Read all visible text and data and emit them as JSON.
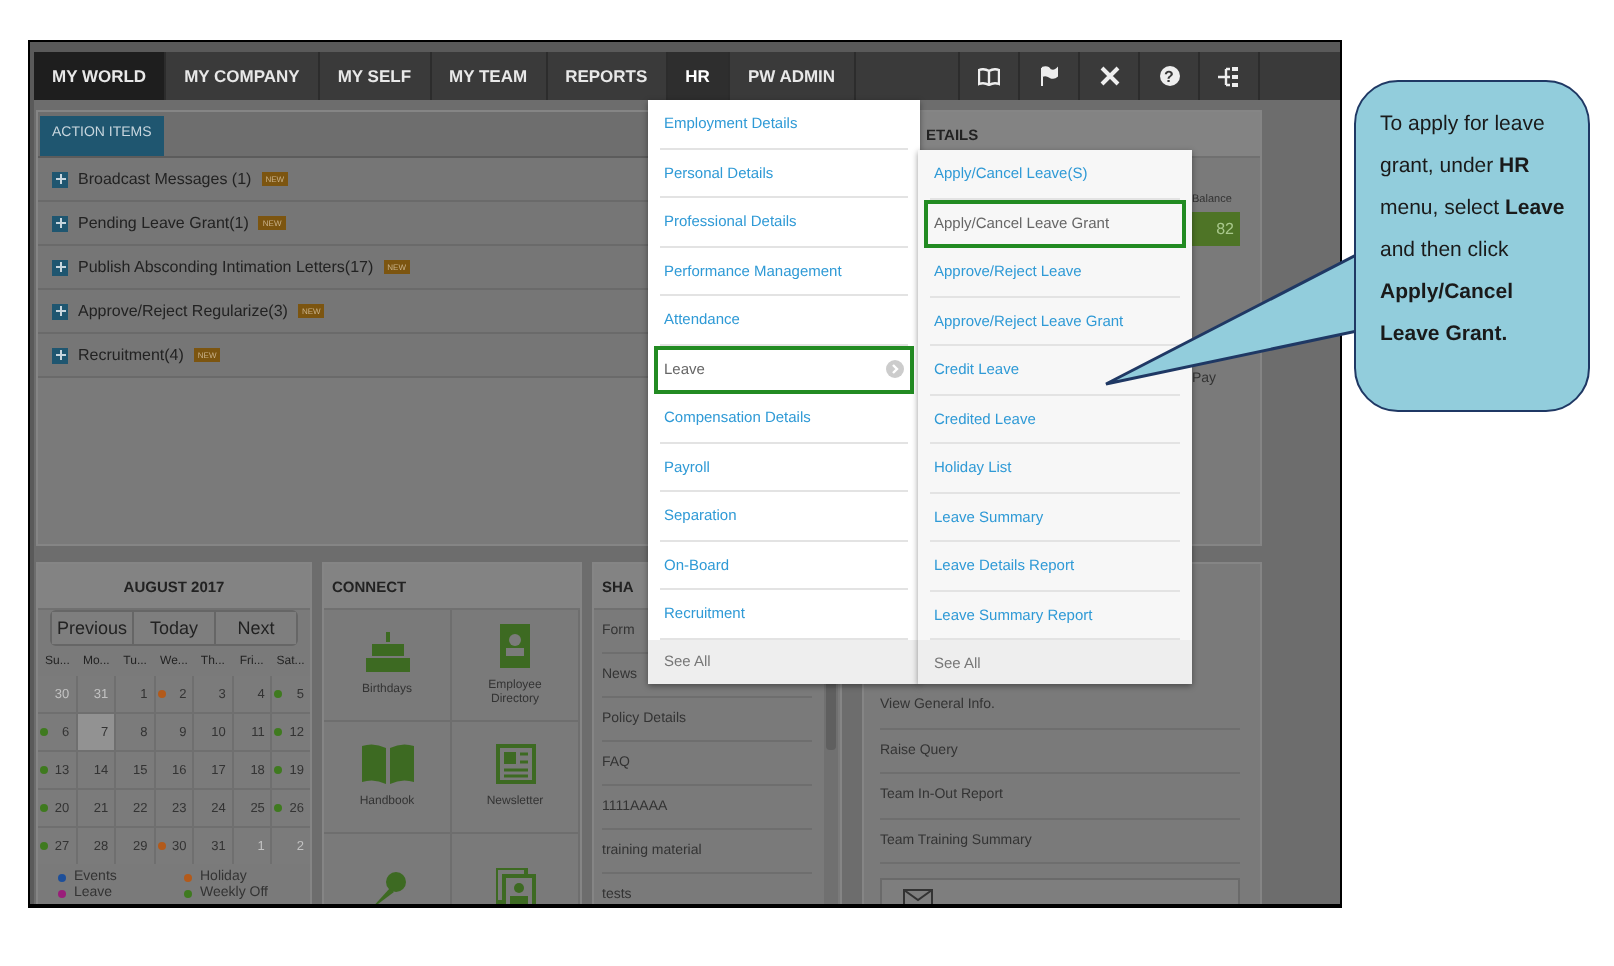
{
  "nav": {
    "tabs": [
      {
        "label": "MY WORLD",
        "selected": true,
        "expanded": false
      },
      {
        "label": "MY COMPANY",
        "selected": false,
        "expanded": false
      },
      {
        "label": "MY SELF",
        "selected": false,
        "expanded": false
      },
      {
        "label": "MY TEAM",
        "selected": false,
        "expanded": false
      },
      {
        "label": "REPORTS",
        "selected": false,
        "expanded": false
      },
      {
        "label": "HR",
        "selected": false,
        "expanded": true
      },
      {
        "label": "PW ADMIN",
        "selected": false,
        "expanded": false
      }
    ],
    "help_glyph": "?"
  },
  "action_items": {
    "tab": "ACTION ITEMS",
    "rows": [
      {
        "label": "Broadcast Messages (1)",
        "badge": "NEW"
      },
      {
        "label": "Pending Leave Grant(1)",
        "badge": "NEW"
      },
      {
        "label": "Publish Absconding Intimation Letters(17)",
        "badge": "NEW"
      },
      {
        "label": "Approve/Reject Regularize(3)",
        "badge": "NEW"
      },
      {
        "label": "Recruitment(4)",
        "badge": "NEW"
      }
    ]
  },
  "details_panel": {
    "title": "ETAILS",
    "balance_label": "Balance",
    "balance_value": "82",
    "pay_label": "Pay"
  },
  "calendar": {
    "title": "AUGUST 2017",
    "buttons": [
      "Previous",
      "Today",
      "Next"
    ],
    "weekdays": [
      "Su...",
      "Mo...",
      "Tu...",
      "We...",
      "Th...",
      "Fri...",
      "Sat..."
    ],
    "weeks": [
      [
        {
          "day": "30",
          "in_month": false,
          "selected": false
        },
        {
          "day": "31",
          "in_month": false,
          "selected": false
        },
        {
          "day": "1",
          "in_month": true,
          "selected": false
        },
        {
          "day": "2",
          "in_month": true,
          "selected": false,
          "color": "#b35a1a"
        },
        {
          "day": "3",
          "in_month": true,
          "selected": false
        },
        {
          "day": "4",
          "in_month": true,
          "selected": false
        },
        {
          "day": "5",
          "in_month": true,
          "selected": false,
          "color": "#3f7a1f"
        }
      ],
      [
        {
          "day": "6",
          "in_month": true,
          "selected": false,
          "color": "#3f7a1f"
        },
        {
          "day": "7",
          "in_month": true,
          "selected": true
        },
        {
          "day": "8",
          "in_month": true,
          "selected": false
        },
        {
          "day": "9",
          "in_month": true,
          "selected": false
        },
        {
          "day": "10",
          "in_month": true,
          "selected": false
        },
        {
          "day": "11",
          "in_month": true,
          "selected": false
        },
        {
          "day": "12",
          "in_month": true,
          "selected": false,
          "color": "#3f7a1f"
        }
      ],
      [
        {
          "day": "13",
          "in_month": true,
          "selected": false,
          "color": "#3f7a1f"
        },
        {
          "day": "14",
          "in_month": true,
          "selected": false
        },
        {
          "day": "15",
          "in_month": true,
          "selected": false
        },
        {
          "day": "16",
          "in_month": true,
          "selected": false
        },
        {
          "day": "17",
          "in_month": true,
          "selected": false
        },
        {
          "day": "18",
          "in_month": true,
          "selected": false
        },
        {
          "day": "19",
          "in_month": true,
          "selected": false,
          "color": "#3f7a1f"
        }
      ],
      [
        {
          "day": "20",
          "in_month": true,
          "selected": false,
          "color": "#3f7a1f"
        },
        {
          "day": "21",
          "in_month": true,
          "selected": false
        },
        {
          "day": "22",
          "in_month": true,
          "selected": false
        },
        {
          "day": "23",
          "in_month": true,
          "selected": false
        },
        {
          "day": "24",
          "in_month": true,
          "selected": false
        },
        {
          "day": "25",
          "in_month": true,
          "selected": false
        },
        {
          "day": "26",
          "in_month": true,
          "selected": false,
          "color": "#3f7a1f"
        }
      ],
      [
        {
          "day": "27",
          "in_month": true,
          "selected": false,
          "color": "#3f7a1f"
        },
        {
          "day": "28",
          "in_month": true,
          "selected": false
        },
        {
          "day": "29",
          "in_month": true,
          "selected": false
        },
        {
          "day": "30",
          "in_month": true,
          "selected": false,
          "color": "#b35a1a"
        },
        {
          "day": "31",
          "in_month": true,
          "selected": false
        },
        {
          "day": "1",
          "in_month": false,
          "selected": false
        },
        {
          "day": "2",
          "in_month": false,
          "selected": false
        }
      ]
    ],
    "legend": [
      {
        "label": "Events",
        "color": "#1d4f9a"
      },
      {
        "label": "Holiday",
        "color": "#b35a1a"
      },
      {
        "label": "Leave",
        "color": "#9a1d7a"
      },
      {
        "label": "Weekly Off",
        "color": "#3f7a1f"
      }
    ]
  },
  "connect": {
    "title": "CONNECT",
    "tiles": [
      "Birthdays",
      "Employee Directory",
      "Handbook",
      "Newsletter"
    ]
  },
  "shared": {
    "title": "SHA",
    "items": [
      "Form",
      "News",
      "Policy Details",
      "FAQ",
      "1111AAAA",
      "training material",
      "tests"
    ]
  },
  "links_panel": {
    "items": [
      "View General Info.",
      "Raise Query",
      "Team In-Out Report",
      "Team Training Summary"
    ]
  },
  "hr_menu": {
    "items": [
      {
        "label": "Employment Details",
        "highlighted": false,
        "expanded": false
      },
      {
        "label": "Personal Details",
        "highlighted": false,
        "expanded": false
      },
      {
        "label": "Professional Details",
        "highlighted": false,
        "expanded": false
      },
      {
        "label": "Performance Management",
        "highlighted": false,
        "expanded": false
      },
      {
        "label": "Attendance",
        "highlighted": false,
        "expanded": false
      },
      {
        "label": "Leave",
        "highlighted": true,
        "expanded": true
      },
      {
        "label": "Compensation Details",
        "highlighted": false,
        "expanded": false
      },
      {
        "label": "Payroll",
        "highlighted": false,
        "expanded": false
      },
      {
        "label": "Separation",
        "highlighted": false,
        "expanded": false
      },
      {
        "label": "On-Board",
        "highlighted": false,
        "expanded": false
      },
      {
        "label": "Recruitment",
        "highlighted": false,
        "expanded": false
      }
    ],
    "see_all": "See All"
  },
  "leave_submenu": {
    "items": [
      {
        "label": "Apply/Cancel Leave(S)",
        "highlighted": false
      },
      {
        "label": "Apply/Cancel Leave Grant",
        "highlighted": true
      },
      {
        "label": "Approve/Reject Leave",
        "highlighted": false
      },
      {
        "label": "Approve/Reject Leave Grant",
        "highlighted": false
      },
      {
        "label": "Credit Leave",
        "highlighted": false
      },
      {
        "label": "Credited Leave",
        "highlighted": false
      },
      {
        "label": "Holiday List",
        "highlighted": false
      },
      {
        "label": "Leave Summary",
        "highlighted": false
      },
      {
        "label": "Leave Details Report",
        "highlighted": false
      },
      {
        "label": "Leave Summary Report",
        "highlighted": false
      }
    ],
    "see_all": "See All"
  },
  "callout": {
    "text": "To apply for leave grant, under **HR** menu, select **Leave** and then click **Apply/Cancel Leave Grant.**"
  }
}
